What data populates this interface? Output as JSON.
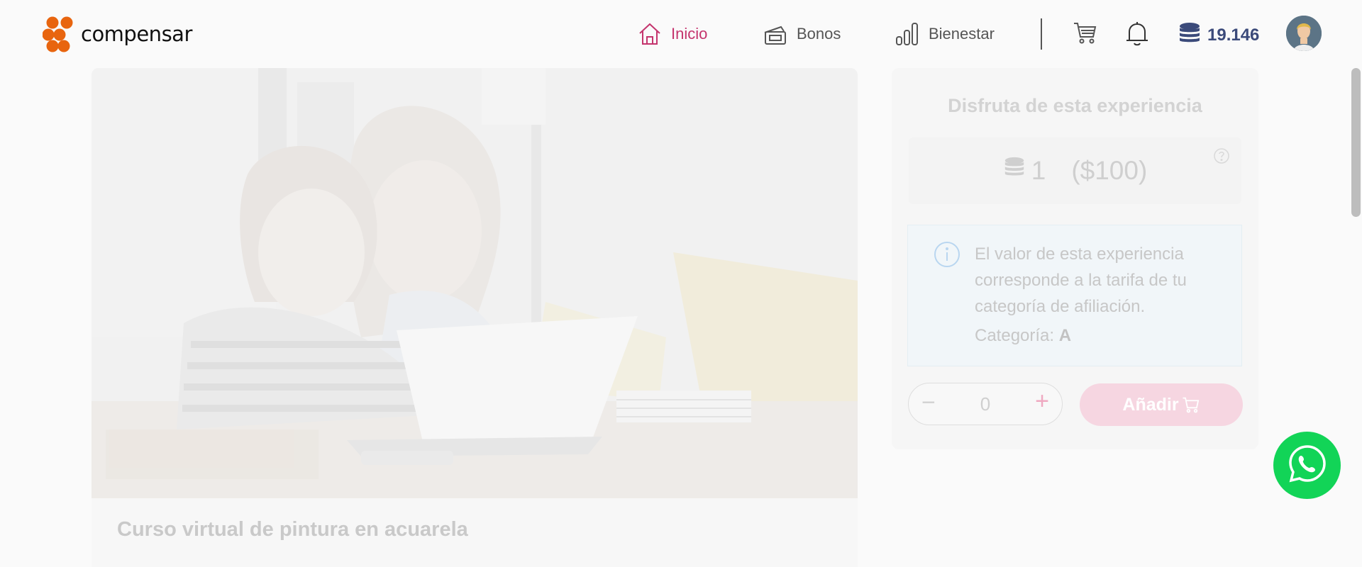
{
  "header": {
    "logo_text": "compensar",
    "nav": [
      {
        "label": "Inicio",
        "icon": "home-icon"
      },
      {
        "label": "Bonos",
        "icon": "ticket-icon"
      },
      {
        "label": "Bienestar",
        "icon": "bar-chart-icon"
      }
    ],
    "points": "19.146",
    "accent_color": "#c4346d",
    "brand_orange": "#e8650f"
  },
  "course": {
    "title": "Curso virtual de pintura en acuarela"
  },
  "panel": {
    "title": "Disfruta de esta experiencia",
    "price_points": "1",
    "price_money": "($100)",
    "info_text": "El valor de esta experiencia corresponde a la tarifa de tu categoría de afiliación.",
    "category_label": "Categoría:",
    "category_value": "A",
    "quantity": "0",
    "minus_symbol": "−",
    "plus_symbol": "+",
    "add_button_label": "Añadir"
  }
}
